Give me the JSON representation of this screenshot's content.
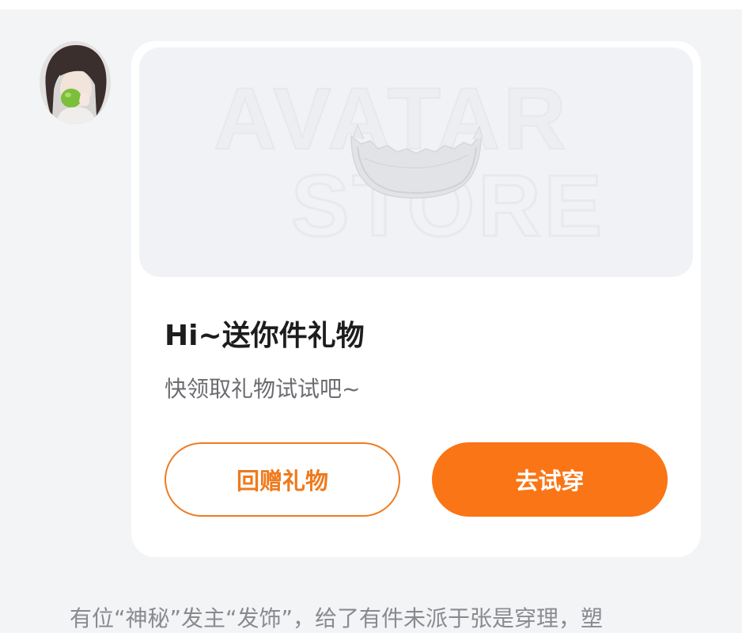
{
  "card": {
    "banner_line1": "AVATAR",
    "banner_line2": "STORE",
    "title": "Hi~送你件礼物",
    "subtitle": "快领取礼物试试吧~",
    "btn_return": "回赠礼物",
    "btn_try": "去试穿"
  },
  "footer": {
    "text": "有位“神秘”发主“发饰”，给了有件未派于张是穿理，塑"
  },
  "colors": {
    "accent": "#fa7516",
    "accent_outline": "#f07a1e",
    "page_bg": "#f3f4f6",
    "card_bg": "#ffffff",
    "banner_bg": "#f1f2f5"
  },
  "icons": {
    "avatar": "user-avatar",
    "banner_item": "crown-icon"
  }
}
